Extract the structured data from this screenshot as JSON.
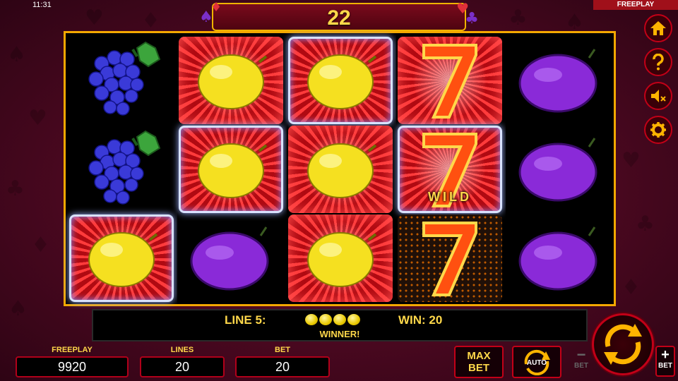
{
  "status_bar": {
    "time": "11:31",
    "mode_tag": "FREEPLAY"
  },
  "banner": {
    "counter": "22"
  },
  "reels": [
    {
      "cells": [
        "grapes",
        "grapes",
        "lemon"
      ]
    },
    {
      "cells": [
        "lemon",
        "lemon",
        "plum"
      ]
    },
    {
      "cells": [
        "lemon",
        "lemon",
        "lemon"
      ]
    },
    {
      "cells": [
        "seven",
        "seven-wild",
        "seven"
      ]
    },
    {
      "cells": [
        "plum",
        "plum",
        "plum"
      ]
    }
  ],
  "wild_label": "WILD",
  "win_info": {
    "line_label": "LINE 5:",
    "win_label": "WIN: 20",
    "winner_text": "WINNER!",
    "line_symbol": "lemon",
    "line_symbol_count": 4
  },
  "stats": {
    "balance": {
      "label": "FREEPLAY",
      "value": "9920"
    },
    "lines": {
      "label": "LINES",
      "value": "20"
    },
    "bet": {
      "label": "BET",
      "value": "20"
    }
  },
  "controls": {
    "max_bet_line1": "MAX",
    "max_bet_line2": "BET",
    "auto_label": "AUTO",
    "bet_minus_symbol": "−",
    "bet_minus_label": "BET",
    "bet_plus_symbol": "+",
    "bet_plus_label": "BET"
  },
  "side_buttons": [
    "home-icon",
    "help-icon",
    "sound-muted-icon",
    "settings-gear-icon"
  ],
  "colors": {
    "accent_gold": "#ffd84a",
    "frame_orange": "#f4a800",
    "button_red": "#c20017",
    "background_maroon": "#4a0820"
  }
}
